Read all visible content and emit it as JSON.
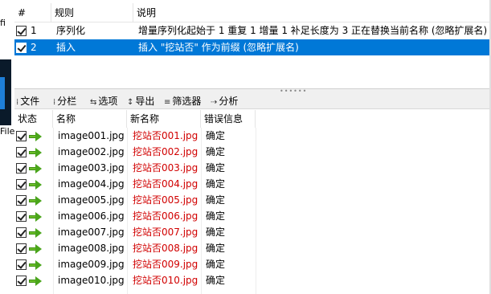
{
  "left_strip": {
    "fragment_top": "fi",
    "fragment_bottom": "File"
  },
  "rules": {
    "headers": {
      "num": "#",
      "rule": "规则",
      "desc": "说明"
    },
    "rows": [
      {
        "num": "1",
        "rule": "序列化",
        "desc": "增量序列化起始于 1 重复 1 增量 1 补足长度为 3 正在替换当前名称 (忽略扩展名)",
        "checked": true,
        "selected": false
      },
      {
        "num": "2",
        "rule": "插入",
        "desc": "插入 \"挖站否\" 作为前缀 (忽略扩展名)",
        "checked": true,
        "selected": true
      }
    ]
  },
  "toolbar": {
    "items": [
      {
        "icon": "file-icon",
        "glyph": "⁞",
        "label": "文件"
      },
      {
        "icon": "columns-icon",
        "glyph": "⁞",
        "label": "分栏"
      },
      {
        "icon": "options-icon",
        "glyph": "⇆",
        "label": "选项"
      },
      {
        "icon": "export-icon",
        "glyph": "↕",
        "label": "导出"
      },
      {
        "icon": "filter-icon",
        "glyph": "≡",
        "label": "筛选器"
      },
      {
        "icon": "analyze-icon",
        "glyph": "⇢",
        "label": "分析"
      }
    ]
  },
  "files": {
    "headers": {
      "status": "状态",
      "name": "名称",
      "new_name": "新名称",
      "error": "错误信息"
    },
    "rows": [
      {
        "name": "image001.jpg",
        "new_name": "挖站否001.jpg",
        "error": "确定"
      },
      {
        "name": "image002.jpg",
        "new_name": "挖站否002.jpg",
        "error": "确定"
      },
      {
        "name": "image003.jpg",
        "new_name": "挖站否003.jpg",
        "error": "确定"
      },
      {
        "name": "image004.jpg",
        "new_name": "挖站否004.jpg",
        "error": "确定"
      },
      {
        "name": "image005.jpg",
        "new_name": "挖站否005.jpg",
        "error": "确定"
      },
      {
        "name": "image006.jpg",
        "new_name": "挖站否006.jpg",
        "error": "确定"
      },
      {
        "name": "image007.jpg",
        "new_name": "挖站否007.jpg",
        "error": "确定"
      },
      {
        "name": "image008.jpg",
        "new_name": "挖站否008.jpg",
        "error": "确定"
      },
      {
        "name": "image009.jpg",
        "new_name": "挖站否009.jpg",
        "error": "确定"
      },
      {
        "name": "image010.jpg",
        "new_name": "挖站否010.jpg",
        "error": "确定"
      }
    ]
  },
  "colors": {
    "selection": "#0078d7",
    "new_name_text": "#d10000",
    "arrow": "#4aa51b"
  }
}
